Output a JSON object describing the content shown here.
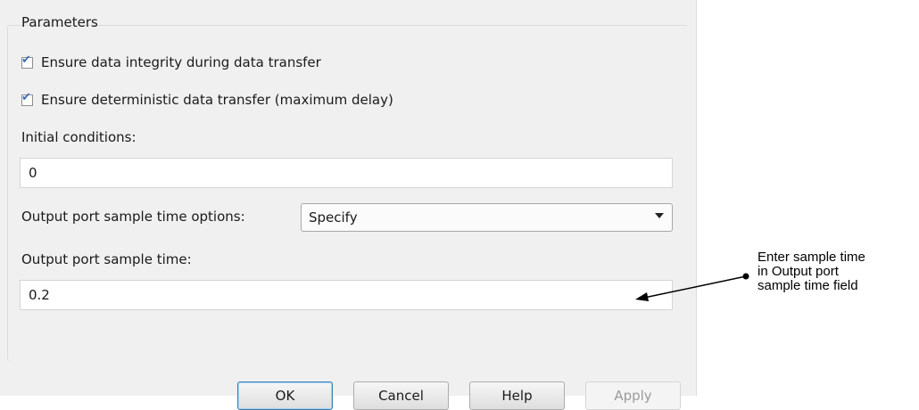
{
  "parameters": {
    "group_title": "Parameters",
    "checkbox_integrity": {
      "label": "Ensure data integrity during data transfer",
      "checked": true
    },
    "checkbox_deterministic": {
      "label": "Ensure deterministic data transfer (maximum delay)",
      "checked": true
    },
    "initial_conditions": {
      "label": "Initial conditions:",
      "value": "0"
    },
    "sample_time_options": {
      "label": "Output port sample time options:",
      "selected": "Specify"
    },
    "sample_time": {
      "label": "Output port sample time:",
      "value": "0.2"
    }
  },
  "buttons": {
    "ok": "OK",
    "cancel": "Cancel",
    "help": "Help",
    "apply": "Apply"
  },
  "annotation": {
    "lines": [
      "Enter sample time",
      "in Output port",
      "sample time field"
    ]
  },
  "icons": {
    "checkmark": "checkmark-icon",
    "dropdown": "chevron-down-icon"
  },
  "colors": {
    "dialog_bg": "#f0f0f0",
    "checkmark": "#3c6bb5",
    "default_button_border": "#3c7fb1"
  }
}
